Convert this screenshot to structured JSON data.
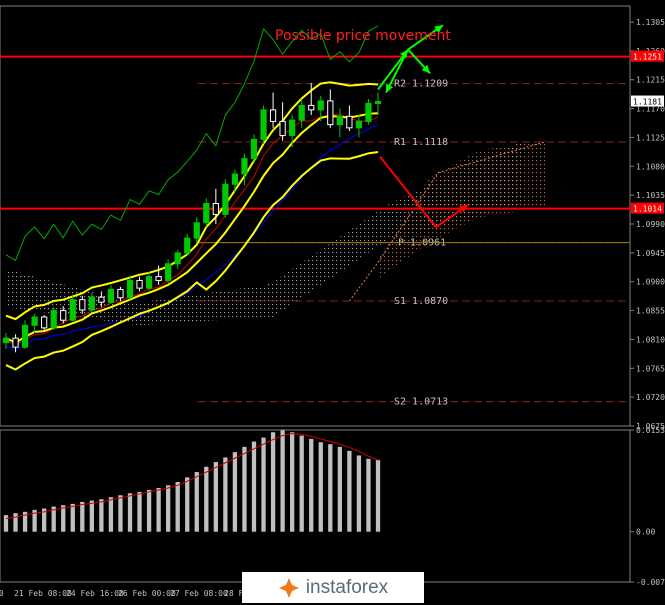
{
  "chart_data": [
    {
      "type": "line",
      "subtype": "candlestick_with_indicators",
      "title": "Possible price movement",
      "y_ticks": [
        "1.1305",
        "1.1260",
        "1.1215",
        "1.1170",
        "1.1125",
        "1.1080",
        "1.1035",
        "1.0990",
        "1.0945",
        "1.0900",
        "1.0855",
        "1.0810",
        "1.0765",
        "1.0720",
        "1.0675"
      ],
      "ylim": [
        1.0675,
        1.133
      ],
      "x_ticks": [
        "00",
        "21 Feb 08:00",
        "24 Feb 16:00",
        "26 Feb 00:00",
        "27 Feb 08:00",
        "28 Feb"
      ],
      "price_labels": {
        "current": "1.1181",
        "resistance": "1.1251",
        "support": "1.1014"
      },
      "resistance_level": 1.1251,
      "support_level": 1.1014,
      "pivot_levels": [
        {
          "label": "R2",
          "value": "1.1209"
        },
        {
          "label": "R1",
          "value": "1.1118"
        },
        {
          "label": "P",
          "value": "1.0961"
        },
        {
          "label": "S1",
          "value": "1.0870"
        },
        {
          "label": "S2",
          "value": "1.0713"
        }
      ],
      "candles": [
        [
          1.0805,
          1.082,
          1.0795,
          1.0812
        ],
        [
          1.0812,
          1.0818,
          1.079,
          1.0798
        ],
        [
          1.0798,
          1.084,
          1.0795,
          1.0832
        ],
        [
          1.0832,
          1.085,
          1.082,
          1.0845
        ],
        [
          1.0845,
          1.0848,
          1.0822,
          1.0828
        ],
        [
          1.0828,
          1.086,
          1.0825,
          1.0855
        ],
        [
          1.0855,
          1.0862,
          1.0835,
          1.084
        ],
        [
          1.084,
          1.088,
          1.0838,
          1.0872
        ],
        [
          1.0872,
          1.0878,
          1.085,
          1.0856
        ],
        [
          1.0856,
          1.0882,
          1.0852,
          1.0876
        ],
        [
          1.0876,
          1.0885,
          1.086,
          1.0868
        ],
        [
          1.0868,
          1.0895,
          1.0865,
          1.0888
        ],
        [
          1.0888,
          1.0892,
          1.087,
          1.0875
        ],
        [
          1.0875,
          1.091,
          1.0872,
          1.0902
        ],
        [
          1.0902,
          1.0908,
          1.0885,
          1.089
        ],
        [
          1.089,
          1.0915,
          1.0886,
          1.0908
        ],
        [
          1.0908,
          1.0925,
          1.0895,
          1.0902
        ],
        [
          1.0902,
          1.0935,
          1.0898,
          1.0928
        ],
        [
          1.0928,
          1.095,
          1.092,
          1.0945
        ],
        [
          1.0945,
          1.0975,
          1.094,
          1.0968
        ],
        [
          1.0968,
          1.1,
          1.096,
          1.0992
        ],
        [
          1.0992,
          1.103,
          1.0985,
          1.1022
        ],
        [
          1.1022,
          1.1045,
          1.099,
          1.1005
        ],
        [
          1.1005,
          1.106,
          1.1,
          1.1052
        ],
        [
          1.1052,
          1.1075,
          1.104,
          1.1068
        ],
        [
          1.1068,
          1.11,
          1.105,
          1.1092
        ],
        [
          1.1092,
          1.113,
          1.1085,
          1.1122
        ],
        [
          1.1122,
          1.1175,
          1.1115,
          1.1168
        ],
        [
          1.1168,
          1.1195,
          1.114,
          1.115
        ],
        [
          1.115,
          1.118,
          1.112,
          1.1128
        ],
        [
          1.1128,
          1.116,
          1.111,
          1.1152
        ],
        [
          1.1152,
          1.1185,
          1.114,
          1.1175
        ],
        [
          1.1175,
          1.121,
          1.116,
          1.1168
        ],
        [
          1.1168,
          1.119,
          1.115,
          1.1182
        ],
        [
          1.1182,
          1.12,
          1.114,
          1.1145
        ],
        [
          1.1145,
          1.117,
          1.1125,
          1.1158
        ],
        [
          1.1158,
          1.1175,
          1.1135,
          1.114
        ],
        [
          1.114,
          1.116,
          1.1125,
          1.115
        ],
        [
          1.115,
          1.1185,
          1.1145,
          1.1178
        ],
        [
          1.1178,
          1.1195,
          1.116,
          1.1181
        ]
      ],
      "histogram_ticks": [
        "0.01534",
        "0.00",
        "-0.00758"
      ],
      "histogram_ylim": [
        -0.00758,
        0.01534
      ],
      "histogram": [
        0.0025,
        0.0028,
        0.003,
        0.0033,
        0.0035,
        0.0038,
        0.004,
        0.0042,
        0.0045,
        0.0047,
        0.0049,
        0.0052,
        0.0055,
        0.0058,
        0.006,
        0.0063,
        0.0066,
        0.007,
        0.0075,
        0.0082,
        0.009,
        0.0098,
        0.0105,
        0.0112,
        0.012,
        0.0128,
        0.0136,
        0.0142,
        0.015,
        0.0153,
        0.015,
        0.0145,
        0.014,
        0.0135,
        0.0132,
        0.0128,
        0.0122,
        0.0115,
        0.011,
        0.0108
      ],
      "histogram_signal": [
        0.002,
        0.0022,
        0.0025,
        0.0028,
        0.003,
        0.0033,
        0.0036,
        0.0038,
        0.0041,
        0.0043,
        0.0045,
        0.0048,
        0.0051,
        0.0054,
        0.0057,
        0.006,
        0.0063,
        0.0066,
        0.007,
        0.0076,
        0.0083,
        0.009,
        0.0097,
        0.0104,
        0.0111,
        0.0118,
        0.0125,
        0.0132,
        0.0139,
        0.0145,
        0.0148,
        0.0147,
        0.0144,
        0.014,
        0.0136,
        0.0132,
        0.0127,
        0.0121,
        0.0114,
        0.0108
      ]
    }
  ],
  "colors": {
    "background": "#000000",
    "resistance": "#ff0000",
    "support": "#ff0000",
    "pivot_dash": "#8b2020",
    "bull": "#00c800",
    "bear": "#ffffff",
    "bollinger": "#ffff00",
    "ma_red": "#cc0000",
    "ma_blue": "#0000ff",
    "green_line": "#00aa00",
    "arrow_green": "#00ff00",
    "arrow_red": "#ff0000",
    "histogram": "#c0c0c0",
    "histogram_signal": "#cc0000",
    "pivot_text": "#c0c0c0",
    "title_text": "#ff2020",
    "axis_text": "#c0c0c0"
  },
  "logo": {
    "text": "instaforex"
  }
}
